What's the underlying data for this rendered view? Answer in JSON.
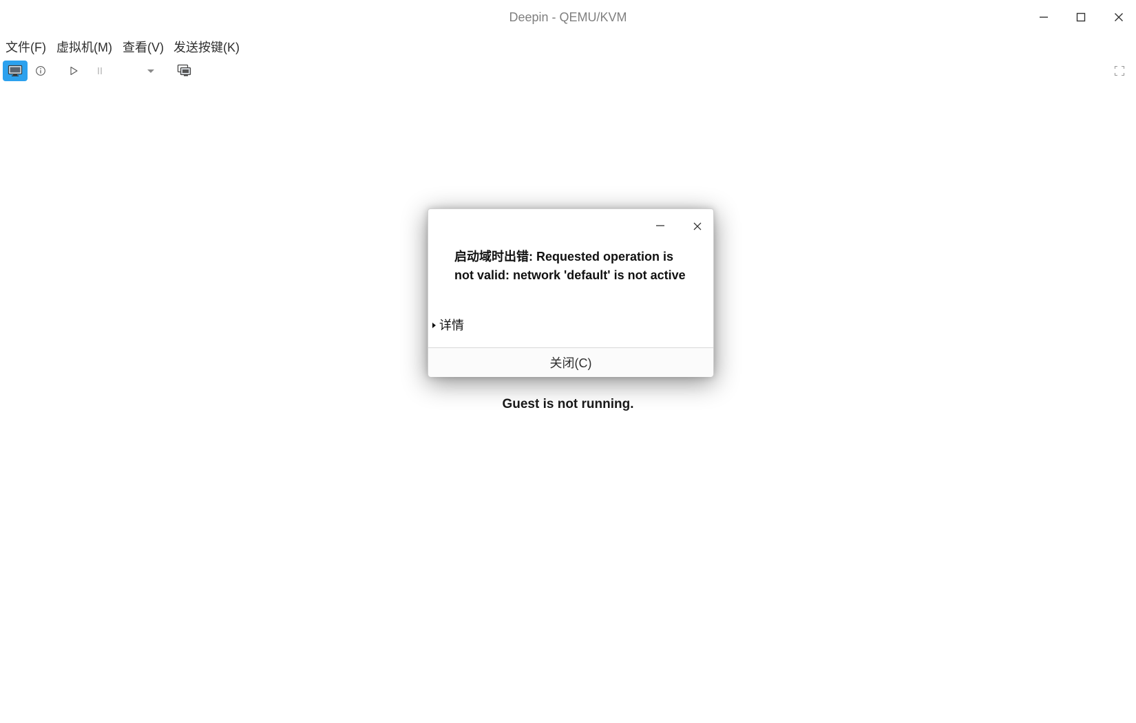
{
  "window": {
    "title": "Deepin - QEMU/KVM",
    "controls": {
      "minimize_icon": "minimize-icon",
      "maximize_icon": "maximize-icon",
      "close_icon": "close-icon"
    }
  },
  "menu": [
    {
      "label": "文件(F)"
    },
    {
      "label": "虚拟机(M)"
    },
    {
      "label": "查看(V)"
    },
    {
      "label": "发送按键(K)"
    }
  ],
  "toolbar": {
    "buttons": [
      {
        "icon": "console-monitor-icon",
        "active": true
      },
      {
        "icon": "info-icon",
        "active": false
      },
      {
        "icon": "play-icon",
        "active": false
      },
      {
        "icon": "pause-icon",
        "active": false
      },
      {
        "icon": "dropdown-arrow-icon",
        "active": false
      },
      {
        "icon": "snapshot-icon",
        "active": false
      },
      {
        "icon": "fullscreen-icon",
        "active": false
      }
    ]
  },
  "main": {
    "status": "Guest is not running."
  },
  "dialog": {
    "message": "启动域时出错: Requested operation is not valid: network 'default' is not active",
    "details_label": "详情",
    "close_label": "关闭(C)"
  },
  "colors": {
    "accent": "#2ca1ee",
    "title_text": "#7f7f7f",
    "text": "#2e2e2e",
    "background": "#ffffff"
  }
}
